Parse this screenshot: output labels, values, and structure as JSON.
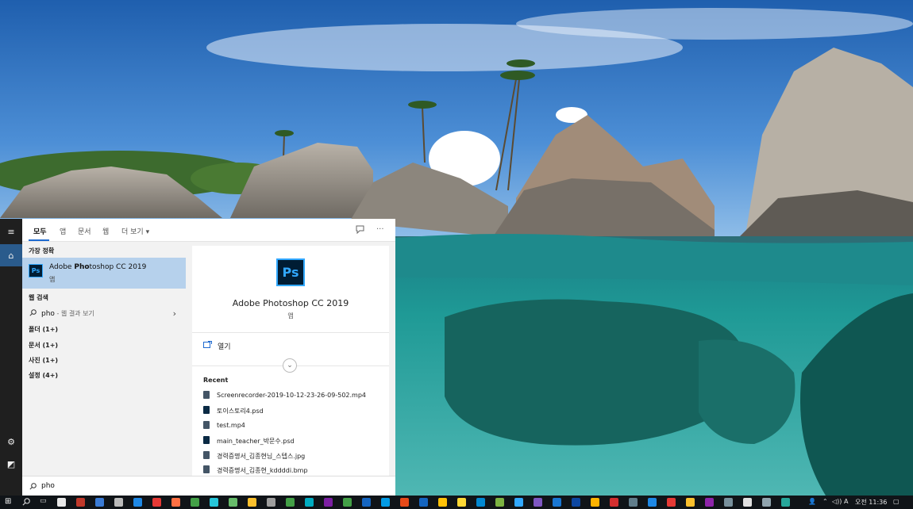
{
  "tabs": {
    "all": "모두",
    "apps": "앱",
    "documents": "문서",
    "web": "웹",
    "more": "더 보기",
    "more_arrow": "▾",
    "feedback_icon": "feedback-icon",
    "options": "···"
  },
  "results": {
    "best_match_title": "가장 정확",
    "best_match": {
      "icon_text": "Ps",
      "name_bold": "Pho",
      "name_prefix": "Adobe ",
      "name_suffix": "toshop CC 2019",
      "type": "앱"
    },
    "web_search_title": "웹 검색",
    "web_query": "pho",
    "web_query_suffix": " - 웹 결과 보기",
    "categories": [
      "폴더 (1+)",
      "문서 (1+)",
      "사진 (1+)",
      "설정 (4+)"
    ]
  },
  "preview": {
    "icon_text": "Ps",
    "title": "Adobe Photoshop CC 2019",
    "type": "앱",
    "open_label": "열기",
    "recent_title": "Recent",
    "recent_files": [
      {
        "name": "Screenrecorder-2019-10-12-23-26-09-502.mp4",
        "kind": "video"
      },
      {
        "name": "토이스토리4.psd",
        "kind": "ps"
      },
      {
        "name": "test.mp4",
        "kind": "video"
      },
      {
        "name": "main_teacher_박문수.psd",
        "kind": "ps"
      },
      {
        "name": "경력증명서_김종현님_스텝스.jpg",
        "kind": "image"
      },
      {
        "name": "경력증명서_김종현_kddddi.bmp",
        "kind": "image"
      }
    ]
  },
  "search_box": {
    "value": "pho"
  },
  "taskbar": {
    "time": "오전 11:36",
    "ime": "A",
    "volume": "◁))",
    "app_colors": [
      "#e8e8e8",
      "#c0392b",
      "#3a7bd5",
      "#bbbbbb",
      "#1e88e5",
      "#e53935",
      "#ff7043",
      "#43a047",
      "#26c6da",
      "#66bb6a",
      "#fbc02d",
      "#9e9e9e",
      "#43a047",
      "#00acc1",
      "#7b1fa2",
      "#43a047",
      "#1565c0",
      "#039be5",
      "#e64a19",
      "#1565c0",
      "#ffc107",
      "#fdd835",
      "#0288d1",
      "#7cb342",
      "#31a8ff",
      "#7e57c2",
      "#1976d2",
      "#0d47a1",
      "#ffb300",
      "#d32f2f",
      "#607d8b",
      "#1e88e5",
      "#e53935",
      "#fbc02d",
      "#8e24aa",
      "#78909c",
      "#e0e0e0",
      "#90a4ae",
      "#26a69a"
    ]
  },
  "colors": {
    "accent": "#1e6ad0",
    "selected": "#b6d1ec",
    "photoshop": "#31a8ff"
  }
}
